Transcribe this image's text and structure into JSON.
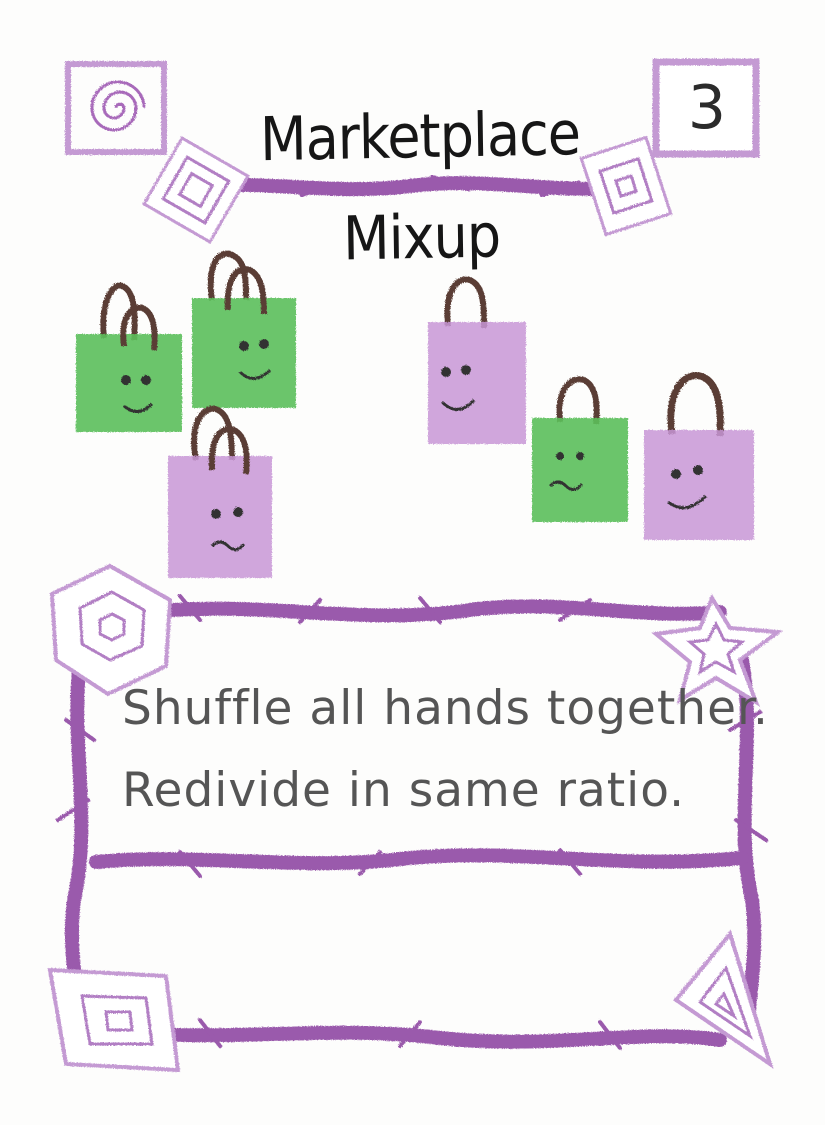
{
  "card": {
    "title": "Marketplace Mixup",
    "cost": "3",
    "rules": [
      "Shuffle all hands together.",
      "Redivide in same ratio."
    ]
  },
  "colors": {
    "purple": "#9a5aac",
    "purple_light": "#c49ad3",
    "green": "#5bbf5b",
    "handle": "#5a3e36",
    "ink": "#161616"
  },
  "icons": [
    "spiral-icon",
    "square-spiral-icon",
    "hexagon-spiral-icon",
    "star-icon",
    "triangle-spiral-icon",
    "shopping-bag-happy-icon",
    "shopping-bag-sad-icon"
  ]
}
